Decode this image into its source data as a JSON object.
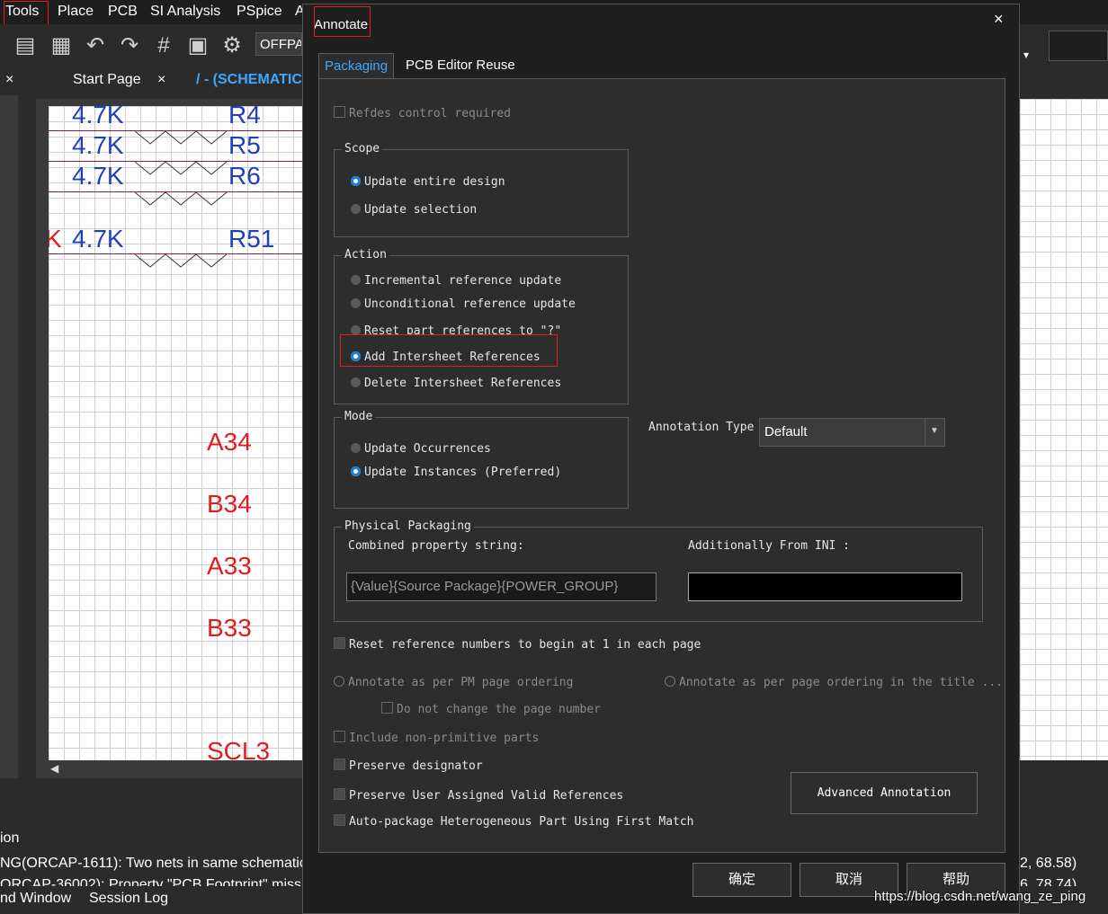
{
  "menubar": {
    "items": [
      "Tools",
      "Place",
      "PCB",
      "SI Analysis",
      "PSpice",
      "A"
    ]
  },
  "toolbar": {
    "offpage_label": "OFFPA"
  },
  "tabs": {
    "close": "×",
    "start_page": "Start Page",
    "schematic": "/ - (SCHEMATIC"
  },
  "schematic": {
    "resistors": [
      "R4",
      "R5",
      "R6",
      "R51"
    ],
    "values": [
      "4.7K",
      "4.7K",
      "4.7K",
      "4.7K"
    ],
    "partial_k": "K",
    "nets": [
      "A34",
      "B34",
      "A33",
      "B33",
      "SCL3"
    ]
  },
  "bottom": {
    "header": "ion",
    "log1": "NG(ORCAP-1611): Two nets in same schematic",
    "log2": "ORCAP-36002): Property \"PCB Footprint\" missi",
    "tabs": [
      "nd Window",
      "Session Log"
    ],
    "coords": "2, 68.58)",
    "coords2": "6, 78.74)"
  },
  "dialog": {
    "title": "Annotate",
    "close": "×",
    "tabs": [
      "Packaging",
      "PCB Editor Reuse"
    ],
    "refdes": "Refdes control required",
    "scope": {
      "legend": "Scope",
      "options": [
        "Update entire design",
        "Update selection"
      ]
    },
    "action": {
      "legend": "Action",
      "options": [
        "Incremental reference update",
        "Unconditional reference update",
        "Reset part references to \"?\"",
        "Add Intersheet References",
        "Delete Intersheet References"
      ]
    },
    "mode": {
      "legend": "Mode",
      "options": [
        "Update Occurrences",
        "Update Instances (Preferred)"
      ]
    },
    "annotation_type": {
      "label": "Annotation Type",
      "value": "Default"
    },
    "physical": {
      "legend": "Physical Packaging",
      "combined_label": "Combined property string:",
      "combined_value": "{Value}{Source Package}{POWER_GROUP}",
      "ini_label": "Additionally From INI :",
      "ini_value": ""
    },
    "reset_numbers": "Reset reference numbers to begin at 1 in each page",
    "annotate_pm": "Annotate as per PM page ordering",
    "annotate_title": "Annotate as per page ordering in the title ...",
    "no_change_page": "Do not change the page number",
    "non_primitive": "Include non-primitive parts",
    "preserve_designator": "Preserve designator",
    "preserve_user": "Preserve User Assigned Valid References",
    "auto_package": "Auto-package Heterogeneous Part Using First Match",
    "advanced_btn": "Advanced Annotation",
    "ok": "确定",
    "cancel": "取消",
    "help": "帮助"
  },
  "watermark": "https://blog.csdn.net/wang_ze_ping",
  "colors": {
    "accent": "#1a7fd4",
    "highlight": "#e02020",
    "net_red": "#e21b1b",
    "part_blue": "#1f3fbf"
  }
}
